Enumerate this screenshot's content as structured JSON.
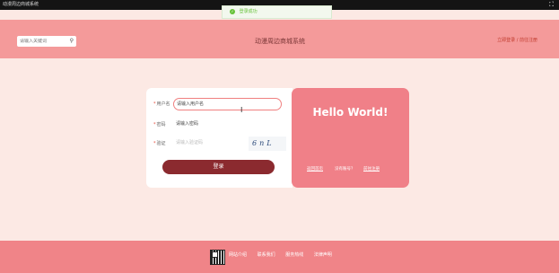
{
  "window": {
    "title": "动漫周边商城系统",
    "fullscreen_icon": "fullscreen-icon"
  },
  "toast": {
    "icon": "check-circle-icon",
    "message": "登录成功"
  },
  "header": {
    "search_placeholder": "请输入关键词",
    "search_icon": "search-icon",
    "site_title": "动漫周边商城系统",
    "links": "立即登录 / 前往注册"
  },
  "login_form": {
    "username_label": "用户名",
    "username_value": "请输入用户名",
    "password_label": "密码",
    "password_value": "请输入密码",
    "captcha_label": "验证",
    "captcha_placeholder": "请输入验证码",
    "captcha_text": "6nL",
    "login_button": "登录"
  },
  "welcome": {
    "heading": "Hello World!",
    "back_link": "返回首页",
    "register_prompt": "没有账号？",
    "register_link": "前往注册"
  },
  "footer": {
    "qr_icon": "qr-code-icon",
    "links": [
      "网站介绍",
      "联系我们",
      "服务热线",
      "法律声明"
    ]
  },
  "colors": {
    "header_bg": "#f49a9a",
    "page_bg": "#fce9e4",
    "accent": "#f08088",
    "button": "#8b2a2f"
  }
}
